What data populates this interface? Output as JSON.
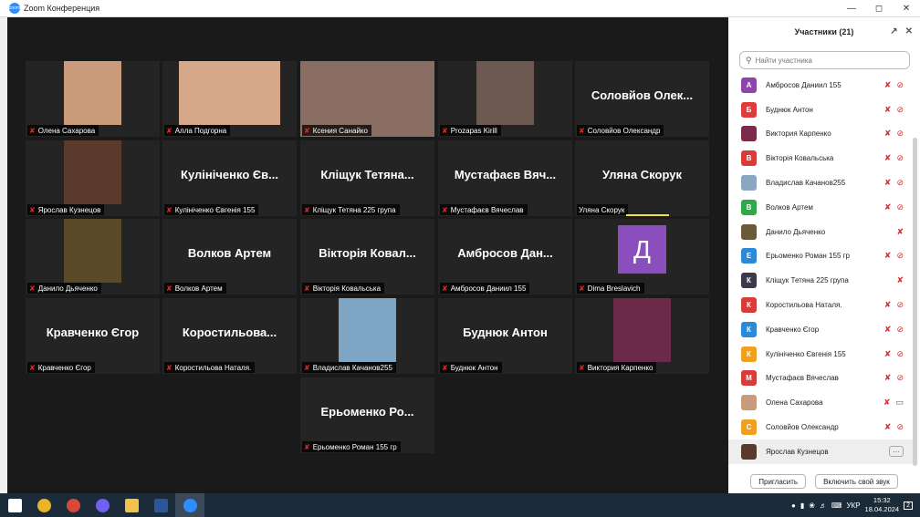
{
  "window": {
    "title": "Zoom Конференция",
    "logo_text": "zoom"
  },
  "gallery": {
    "tiles": [
      {
        "label": "Олена Сахарова",
        "type": "video",
        "photo_color": "#c99b7a"
      },
      {
        "label": "Алла Подгорна",
        "type": "video",
        "photo_color": "#d6a88a"
      },
      {
        "label": "Ксения Санайко",
        "type": "video",
        "active": true,
        "photo_color": "#8a6d62"
      },
      {
        "label": "Prozapas Kirill",
        "type": "video",
        "photo_color": "#6c5a52"
      },
      {
        "label": "Соловйов Олександр",
        "type": "name",
        "display": "Соловйов Олек..."
      },
      {
        "label": "Ярослав Кузнецов",
        "type": "video",
        "photo_color": "#5a3a2c"
      },
      {
        "label": "Кулініченко Євгенія 155",
        "type": "name",
        "display": "Кулініченко Єв..."
      },
      {
        "label": "Кліщук Тетяна 225 група",
        "type": "name",
        "display": "Кліщук Тетяна..."
      },
      {
        "label": "Мустафаєв Вячеслав",
        "type": "name",
        "display": "Мустафаєв Вяч..."
      },
      {
        "label": "Уляна Скорук",
        "type": "name",
        "display": "Уляна Скорук",
        "speaking": true,
        "nomic": true
      },
      {
        "label": "Данило Дьяченко",
        "type": "video",
        "photo_color": "#5b4a2a"
      },
      {
        "label": "Волков Артем",
        "type": "name",
        "display": "Волков Артем"
      },
      {
        "label": "Вікторія Ковальська",
        "type": "name",
        "display": "Вікторія Ковал..."
      },
      {
        "label": "Амбросов Даниил 155",
        "type": "name",
        "display": "Амбросов Дан..."
      },
      {
        "label": "Dima Breslavich",
        "type": "letter",
        "letter": "Д"
      },
      {
        "label": "Кравченко Єгор",
        "type": "name",
        "display": "Кравченко Єгор"
      },
      {
        "label": "Коростильова Наталя.",
        "type": "name",
        "display": "Коростильова..."
      },
      {
        "label": "Владислав Качанов255",
        "type": "video",
        "photo_color": "#7ea6c4"
      },
      {
        "label": "Буднюк Антон",
        "type": "name",
        "display": "Буднюк Антон"
      },
      {
        "label": "Виктория Карпенко",
        "type": "video",
        "photo_color": "#6b2a4a"
      },
      {
        "label": "Ерьоменко Роман 155 гр",
        "type": "name",
        "display": "Ерьоменко Ро..."
      }
    ]
  },
  "panel": {
    "title": "Участники (21)",
    "search_placeholder": "Найти участника",
    "participants": [
      {
        "initial": "А",
        "name": "Амбросов Даниил 155",
        "color": "#8e44ad",
        "video": false
      },
      {
        "initial": "Б",
        "name": "Буднюк Антон",
        "color": "#e03b3b",
        "video": false
      },
      {
        "initial": "",
        "name": "Виктория Карпенко",
        "color": "#7a2a4a",
        "video": false
      },
      {
        "initial": "В",
        "name": "Вікторія Ковальська",
        "color": "#d93a3a",
        "video": false
      },
      {
        "initial": "",
        "name": "Владислав Качанов255",
        "color": "#8aa6c0",
        "video": false
      },
      {
        "initial": "В",
        "name": "Волков Артем",
        "color": "#2eaa4a",
        "video": false
      },
      {
        "initial": "",
        "name": "Данило Дьяченко",
        "color": "#6b5a3a",
        "video": false,
        "mic_only": true
      },
      {
        "initial": "Е",
        "name": "Ерьоменко Роман 155 гр",
        "color": "#2a8ad8",
        "video": false
      },
      {
        "initial": "К",
        "name": "Кліщук Тетяна 225 група",
        "color": "#3a3a4a",
        "video": false,
        "mic_only": true
      },
      {
        "initial": "К",
        "name": "Коростильова Наталя.",
        "color": "#d93a3a",
        "video": false
      },
      {
        "initial": "К",
        "name": "Кравченко Єгор",
        "color": "#2a8ad8",
        "video": false
      },
      {
        "initial": "К",
        "name": "Кулініченко Євгенія 155",
        "color": "#f0a020",
        "video": false
      },
      {
        "initial": "М",
        "name": "Мустафаєв Вячеслав",
        "color": "#d93a3a",
        "video": false
      },
      {
        "initial": "",
        "name": "Олена Сахарова",
        "color": "#c99b7a",
        "video": true
      },
      {
        "initial": "С",
        "name": "Соловйов Олександр",
        "color": "#f0a020",
        "video": false
      },
      {
        "initial": "",
        "name": "Ярослав Кузнецов",
        "color": "#5a3a2c",
        "video": true,
        "highlight": true
      }
    ],
    "invite_label": "Пригласить",
    "unmute_label": "Включить свой звук"
  },
  "taskbar": {
    "time": "15:32",
    "date": "18.04.2024",
    "lang": "УКР",
    "notif_count": "2",
    "apps": [
      "windows-start",
      "chrome",
      "chrome-alt",
      "viber",
      "file-explorer",
      "word",
      "zoom"
    ]
  }
}
